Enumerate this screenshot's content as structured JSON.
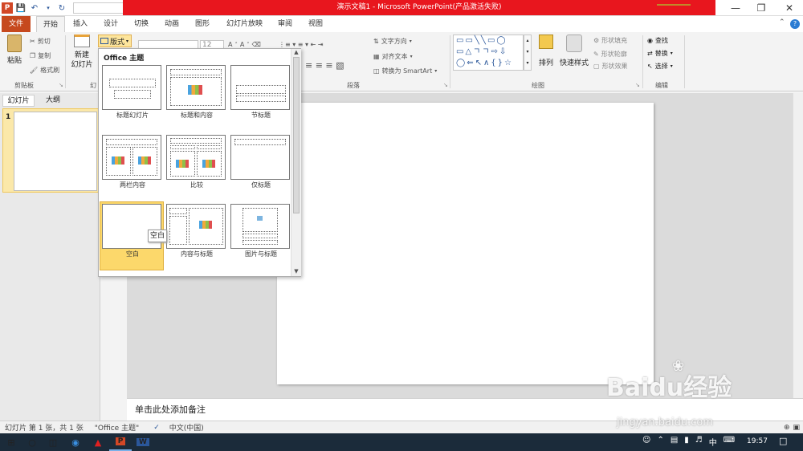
{
  "window": {
    "title": "演示文稿1 - Microsoft PowerPoint(产品激活失败)"
  },
  "tabs": [
    "文件",
    "开始",
    "插入",
    "设计",
    "切换",
    "动画",
    "图形",
    "幻灯片放映",
    "审阅",
    "视图"
  ],
  "ribbon": {
    "clipboard": {
      "paste": "粘贴",
      "cut": "剪切",
      "copy": "复制",
      "format_painter": "格式刷",
      "group": "剪贴板"
    },
    "slides": {
      "new_slide": "新建\n幻灯片",
      "layout": "版式",
      "group": "幻"
    },
    "font": {
      "size": "12"
    },
    "paragraph": {
      "text_direction": "文字方向",
      "align_text": "对齐文本",
      "smartart": "转换为 SmartArt",
      "group": "段落"
    },
    "drawing": {
      "arrange": "排列",
      "quick_styles": "快速样式",
      "shape_fill": "形状填充",
      "shape_outline": "形状轮廓",
      "shape_effects": "形状效果",
      "group": "绘图"
    },
    "editing": {
      "find": "查找",
      "replace": "替换",
      "select": "选择",
      "group": "编辑"
    }
  },
  "left_panel": {
    "tab_slides": "幻灯片",
    "tab_outline": "大纲",
    "slide_number": "1"
  },
  "layout_menu": {
    "title": "Office 主题",
    "items": [
      "标题幻灯片",
      "标题和内容",
      "节标题",
      "两栏内容",
      "比较",
      "仅标题",
      "空白",
      "内容与标题",
      "图片与标题"
    ],
    "selected": "空白",
    "tooltip": "空白"
  },
  "notes": {
    "placeholder": "单击此处添加备注"
  },
  "status": {
    "slide_info": "幻灯片 第 1 张，共 1 张",
    "theme": "\"Office 主题\"",
    "language": "中文(中国)"
  },
  "taskbar": {
    "time": "19:57",
    "ime": "中"
  },
  "watermark": {
    "brand": "Baidu经验",
    "url": "jingyan.baidu.com"
  },
  "colors": {
    "title_red": "#e8161e",
    "file_tab": "#c6491e",
    "selected_layout": "#fcd86b"
  }
}
